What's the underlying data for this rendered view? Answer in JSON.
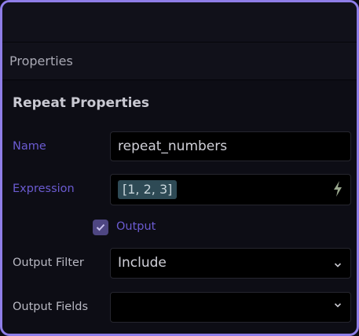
{
  "panel": {
    "tab_label": "Properties",
    "section_title": "Repeat Properties"
  },
  "fields": {
    "name": {
      "label": "Name",
      "value": "repeat_numbers"
    },
    "expression": {
      "label": "Expression",
      "value": "[1, 2, 3]",
      "icon": "lightning-bolt-icon"
    },
    "output": {
      "label": "Output",
      "checked": true
    },
    "output_filter": {
      "label": "Output Filter",
      "value": "Include"
    },
    "output_fields": {
      "label": "Output Fields",
      "value": ""
    }
  },
  "colors": {
    "accent": "#6b5bd1",
    "frame_border": "#8f7ee8",
    "chip_bg": "#2e4a55",
    "bolt": "#9aa88e"
  }
}
